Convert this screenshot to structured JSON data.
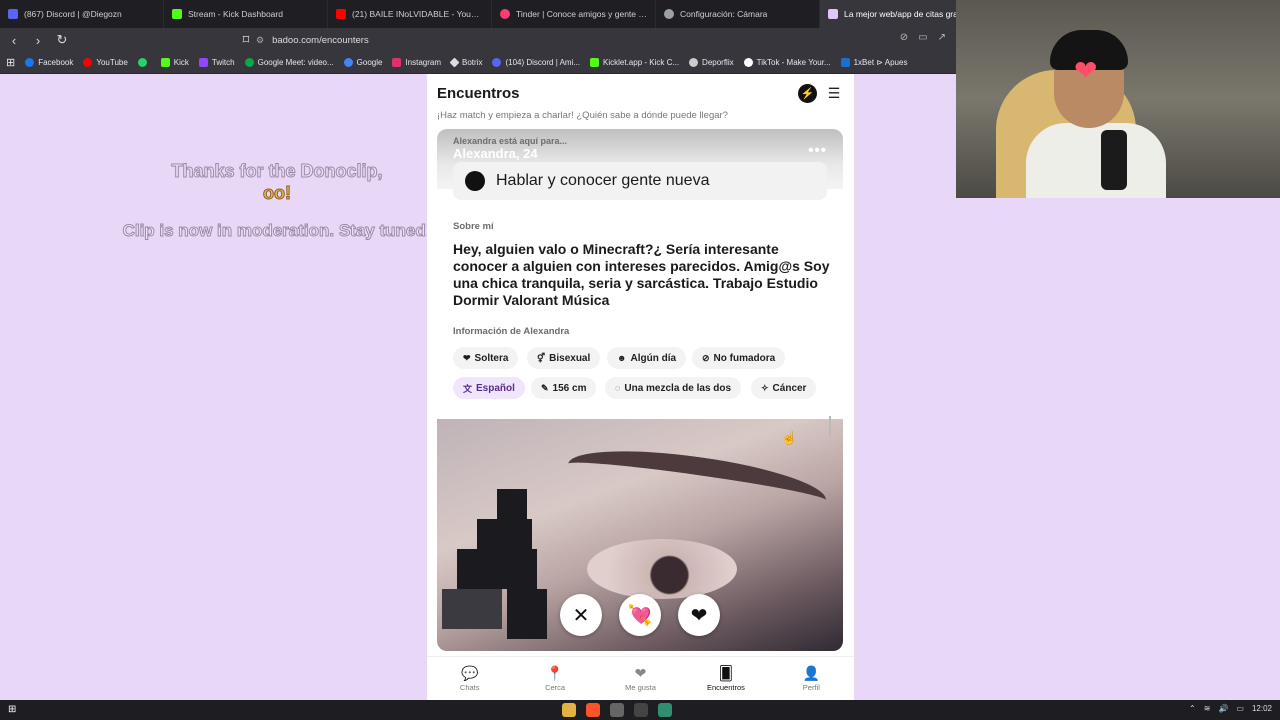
{
  "browser": {
    "tabs": [
      {
        "label": "(867) Discord | @Diegozn",
        "color": "#5865f2"
      },
      {
        "label": "Stream - Kick Dashboard",
        "color": "#53fc18"
      },
      {
        "label": "(21) BAILE INoLVIDABLE - YouTube",
        "color": "#ff0000"
      },
      {
        "label": "Tinder | Conoce amigos y gente nue",
        "color": "#fe3c72"
      },
      {
        "label": "Configuración: Cámara",
        "color": "#9aa0a6"
      },
      {
        "label": "La mejor web/app de citas grat",
        "color": "#e0c6f7"
      }
    ],
    "url": "badoo.com/encounters",
    "bookmarks": [
      {
        "label": "Facebook",
        "color": "#1877f2"
      },
      {
        "label": "YouTube",
        "color": "#ff0000"
      },
      {
        "label": "",
        "color": "#25d366"
      },
      {
        "label": "Kick",
        "color": "#53fc18"
      },
      {
        "label": "Twitch",
        "color": "#9146ff"
      },
      {
        "label": "Google Meet: video...",
        "color": "#00ac47"
      },
      {
        "label": "Google",
        "color": "#4285f4"
      },
      {
        "label": "Instagram",
        "color": "#e1306c"
      },
      {
        "label": "Botrix",
        "color": "#dddddd"
      },
      {
        "label": "(104) Discord | Ami...",
        "color": "#5865f2"
      },
      {
        "label": "Kicklet.app - Kick C...",
        "color": "#53fc18"
      },
      {
        "label": "Deporflix",
        "color": "#cccccc"
      },
      {
        "label": "TikTok - Make Your...",
        "color": "#ffffff"
      },
      {
        "label": "1xBet ⊳ Apues",
        "color": "#1a6fd1"
      }
    ]
  },
  "overlay": {
    "line1": "Thanks for the Donoclip,",
    "line2": "oo!",
    "line3": "Clip is now in moderation. Stay tuned!"
  },
  "app": {
    "title": "Encuentros",
    "subtitle": "¡Haz match y empieza a charlar! ¿Quién sabe a dónde puede llegar?",
    "profile": {
      "here_for": "Alexandra está aquí para...",
      "name_age": "Alexandra, 24",
      "intent": "Hablar y conocer gente nueva",
      "about_label": "Sobre mí",
      "about": "Hey, alguien valo o Minecraft?¿ Sería interesante conocer a alguien con intereses parecidos. Amig@s Soy una chica tranquila, seria y sarcástica. Trabajo Estudio Dormir Valorant Música",
      "info_label": "Información de Alexandra",
      "chips": [
        {
          "icon": "heart-icon",
          "glyph": "❤",
          "label": "Soltera"
        },
        {
          "icon": "gender-icon",
          "glyph": "⚥",
          "label": "Bisexual"
        },
        {
          "icon": "child-icon",
          "glyph": "☻",
          "label": "Algún día"
        },
        {
          "icon": "no-smoking-icon",
          "glyph": "⊘",
          "label": "No fumadora"
        },
        {
          "icon": "translate-icon",
          "glyph": "文",
          "label": "Español"
        },
        {
          "icon": "ruler-icon",
          "glyph": "✎",
          "label": "156 cm"
        },
        {
          "icon": "bubble-icon",
          "glyph": "◌",
          "label": "Una mezcla de las dos"
        },
        {
          "icon": "zodiac-icon",
          "glyph": "✧",
          "label": "Cáncer"
        }
      ]
    },
    "nav": [
      {
        "label": "Chats",
        "glyph": "💬"
      },
      {
        "label": "Cerca",
        "glyph": "📍"
      },
      {
        "label": "Me gusta",
        "glyph": "❤"
      },
      {
        "label": "Encuentros",
        "glyph": "🂠"
      },
      {
        "label": "Perfil",
        "glyph": "👤"
      }
    ]
  },
  "taskbar": {
    "clock": "12:02"
  }
}
